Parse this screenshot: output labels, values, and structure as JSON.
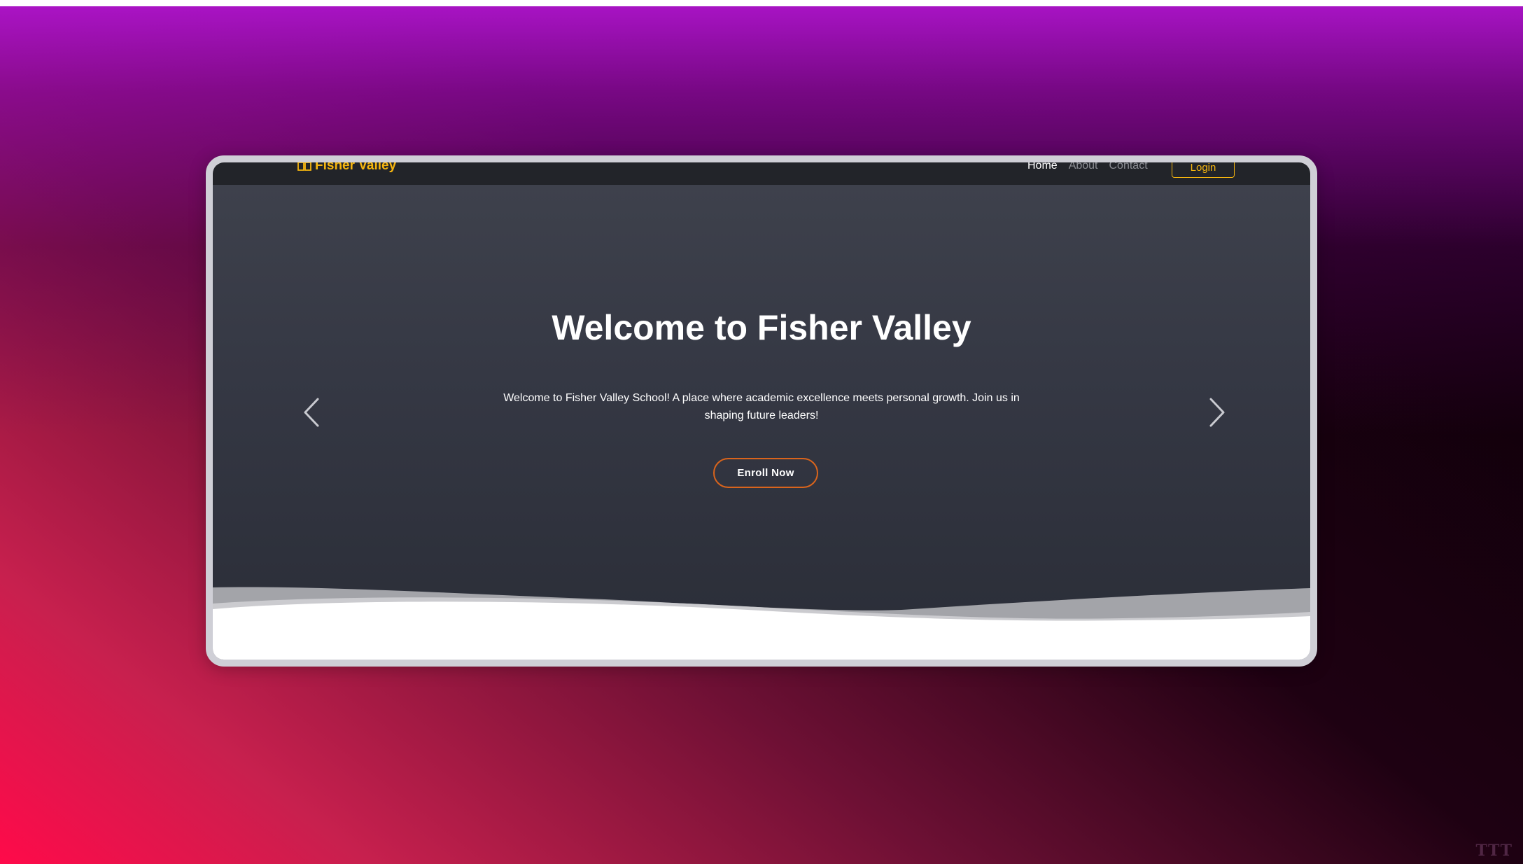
{
  "brand": {
    "name": "Fisher Valley",
    "icon": "book-icon",
    "color": "#f5b50f"
  },
  "nav": {
    "items": [
      {
        "label": "Home",
        "active": true
      },
      {
        "label": "About",
        "active": false
      },
      {
        "label": "Contact",
        "active": false
      }
    ],
    "login_label": "Login"
  },
  "hero": {
    "title": "Welcome to Fisher Valley",
    "text": "Welcome to Fisher Valley School! A place where academic excellence meets personal growth. Join us in shaping future leaders!",
    "cta_label": "Enroll Now",
    "cta_border_color": "#d9641c",
    "prev_icon": "chevron-left-icon",
    "next_icon": "chevron-right-icon"
  },
  "watermark": "TTT"
}
